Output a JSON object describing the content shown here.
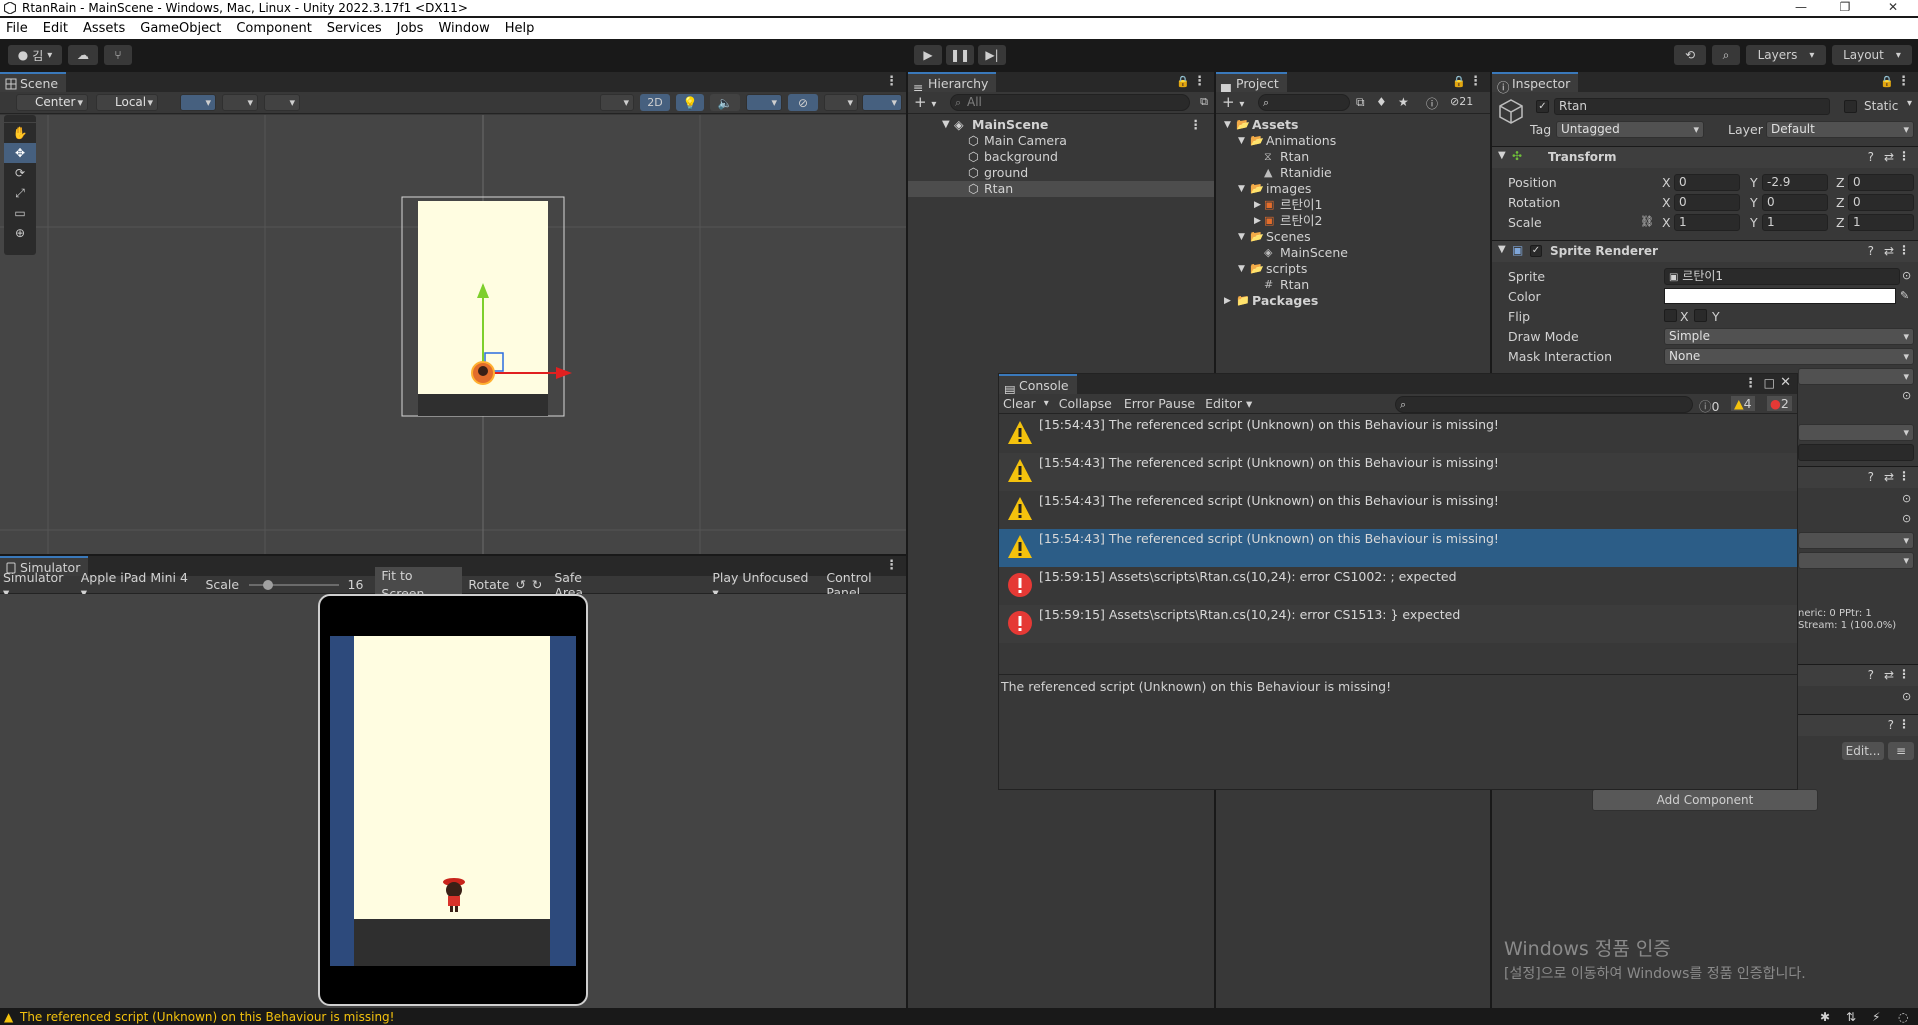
{
  "window": {
    "title": "RtanRain - MainScene - Windows, Mac, Linux - Unity 2022.3.17f1 <DX11>"
  },
  "menu": [
    "File",
    "Edit",
    "Assets",
    "GameObject",
    "Component",
    "Services",
    "Jobs",
    "Window",
    "Help"
  ],
  "toolbar": {
    "account": "김",
    "layers": "Layers",
    "layout": "Layout"
  },
  "scene": {
    "tab": "Scene",
    "pivot": "Center",
    "space": "Local",
    "mode_2d": "2D"
  },
  "simulator": {
    "tab": "Simulator",
    "mode": "Simulator",
    "device": "Apple iPad Mini 4",
    "scale_label": "Scale",
    "scale_value": "16",
    "fit": "Fit to Screen",
    "rotate": "Rotate",
    "safe_area": "Safe Area",
    "play_focus": "Play Unfocused",
    "control_panel": "Control Panel"
  },
  "hierarchy": {
    "tab": "Hierarchy",
    "search_placeholder": "All",
    "scene": "MainScene",
    "items": [
      "Main Camera",
      "background",
      "ground",
      "Rtan"
    ]
  },
  "project": {
    "tab": "Project",
    "hidden_count": "21",
    "tree": [
      {
        "label": "Assets",
        "depth": 0,
        "kind": "folder-open",
        "bold": true
      },
      {
        "label": "Animations",
        "depth": 1,
        "kind": "folder-open"
      },
      {
        "label": "Rtan",
        "depth": 2,
        "kind": "anim-controller"
      },
      {
        "label": "Rtanidie",
        "depth": 2,
        "kind": "anim-clip"
      },
      {
        "label": "images",
        "depth": 1,
        "kind": "folder-open"
      },
      {
        "label": "르탄이1",
        "depth": 2,
        "kind": "sprite"
      },
      {
        "label": "르탄이2",
        "depth": 2,
        "kind": "sprite"
      },
      {
        "label": "Scenes",
        "depth": 1,
        "kind": "folder-open"
      },
      {
        "label": "MainScene",
        "depth": 2,
        "kind": "scene"
      },
      {
        "label": "scripts",
        "depth": 1,
        "kind": "folder-open"
      },
      {
        "label": "Rtan",
        "depth": 2,
        "kind": "script"
      },
      {
        "label": "Packages",
        "depth": 0,
        "kind": "folder-closed",
        "bold": true
      }
    ]
  },
  "inspector": {
    "tab": "Inspector",
    "object_name": "Rtan",
    "static_label": "Static",
    "tag_label": "Tag",
    "tag_value": "Untagged",
    "layer_label": "Layer",
    "layer_value": "Default",
    "transform": {
      "title": "Transform",
      "position_label": "Position",
      "position": {
        "x": "0",
        "y": "-2.9",
        "z": "0"
      },
      "rotation_label": "Rotation",
      "rotation": {
        "x": "0",
        "y": "0",
        "z": "0"
      },
      "scale_label": "Scale",
      "scale": {
        "x": "1",
        "y": "1",
        "z": "1"
      }
    },
    "sprite_renderer": {
      "title": "Sprite Renderer",
      "sprite_label": "Sprite",
      "sprite_value": "르탄이1",
      "color_label": "Color",
      "flip_label": "Flip",
      "flip_x": "X",
      "flip_y": "Y",
      "draw_mode_label": "Draw Mode",
      "draw_mode_value": "Simple",
      "mask_label": "Mask Interaction",
      "mask_value": "None"
    },
    "partial_info_1": "neric: 0 PPtr: 1",
    "partial_info_2": "Stream: 1 (100.0%)",
    "edit_button": "Edit...",
    "add_component": "Add Component"
  },
  "console": {
    "tab": "Console",
    "clear": "Clear",
    "collapse": "Collapse",
    "error_pause": "Error Pause",
    "editor": "Editor",
    "info_count": "0",
    "warning_count": "4",
    "error_count": "2",
    "logs": [
      {
        "type": "warning",
        "text": "[15:54:43] The referenced script (Unknown) on this Behaviour is missing!",
        "selected": false
      },
      {
        "type": "warning",
        "text": "[15:54:43] The referenced script (Unknown) on this Behaviour is missing!",
        "selected": false
      },
      {
        "type": "warning",
        "text": "[15:54:43] The referenced script (Unknown) on this Behaviour is missing!",
        "selected": false
      },
      {
        "type": "warning",
        "text": "[15:54:43] The referenced script (Unknown) on this Behaviour is missing!",
        "selected": true
      },
      {
        "type": "error",
        "text": "[15:59:15] Assets\\scripts\\Rtan.cs(10,24): error CS1002: ; expected",
        "selected": false
      },
      {
        "type": "error",
        "text": "[15:59:15] Assets\\scripts\\Rtan.cs(10,24): error CS1513: } expected",
        "selected": false
      }
    ],
    "detail": "The referenced script (Unknown) on this Behaviour is missing!"
  },
  "watermark": {
    "title": "Windows 정품 인증",
    "subtitle": "[설정]으로 이동하여 Windows를 정품 인증합니다."
  },
  "status": {
    "message": "The referenced script (Unknown) on this Behaviour is missing!"
  },
  "colors": {
    "selection": "#2c5d87",
    "accent": "#3a79bb",
    "warning": "#f4c20d",
    "error": "#e53935",
    "game_bg": "#fffde1",
    "device_border": "#2d4a7c"
  }
}
